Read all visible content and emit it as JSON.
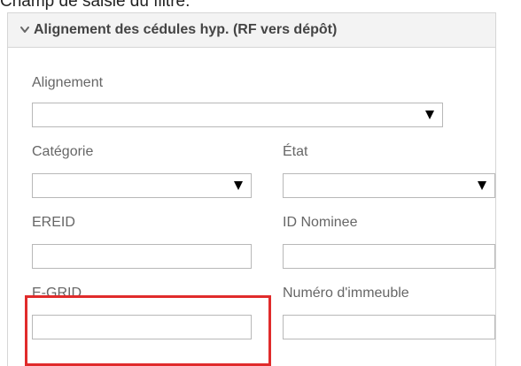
{
  "page": {
    "caption": "Champ de saisie du filtre."
  },
  "panel": {
    "title": "Alignement des cédules hyp. (RF vers dépôt)",
    "chevron_icon": "chevron-down-icon"
  },
  "form": {
    "alignement": {
      "label": "Alignement",
      "value": ""
    },
    "categorie": {
      "label": "Catégorie",
      "value": ""
    },
    "etat": {
      "label": "État",
      "value": ""
    },
    "ereid": {
      "label": "EREID",
      "value": ""
    },
    "id_nominee": {
      "label": "ID Nominee",
      "value": ""
    },
    "egrid": {
      "label": "E-GRID",
      "value": ""
    },
    "numero_immeuble": {
      "label": "Numéro d'immeuble",
      "value": ""
    }
  },
  "highlight": {
    "color": "#e02b2b",
    "target": "E-GRID"
  }
}
